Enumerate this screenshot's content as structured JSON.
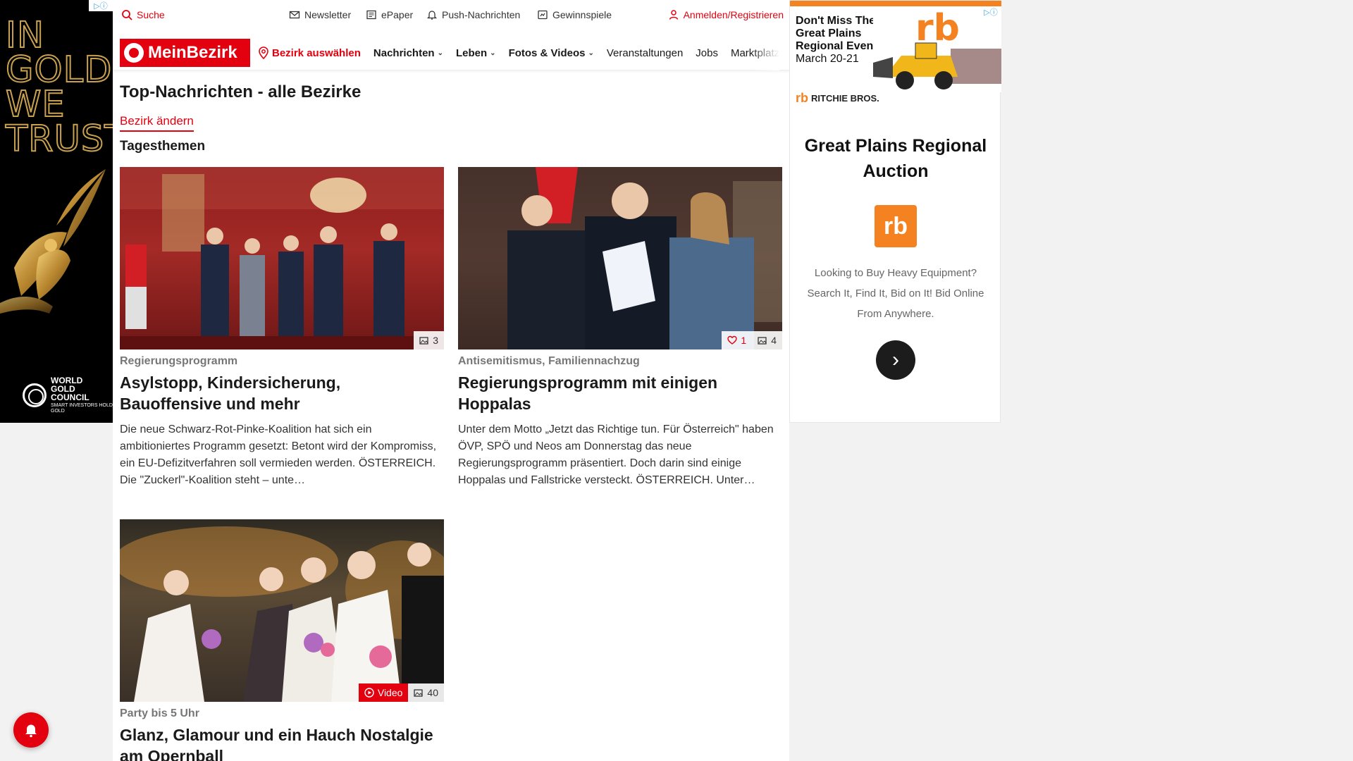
{
  "utility": {
    "search": "Suche",
    "newsletter": "Newsletter",
    "epaper": "ePaper",
    "push": "Push-Nachrichten",
    "games": "Gewinnspiele",
    "login": "Anmelden/Registrieren"
  },
  "nav": {
    "logo": "MeinBezirk",
    "district_select": "Bezirk auswählen",
    "items": [
      "Nachrichten",
      "Leben",
      "Fotos & Videos",
      "Veranstaltungen",
      "Jobs",
      "Marktplatz"
    ]
  },
  "main": {
    "title": "Top-Nachrichten - alle Bezirke",
    "change_district": "Bezirk ändern",
    "section": "Tagesthemen"
  },
  "articles": [
    {
      "topic": "Regierungsprogramm",
      "headline": "Asylstopp, Kindersicherung, Bauoffensive und mehr",
      "teaser": "Die neue Schwarz-Rot-Pinke-Koalition hat sich ein ambitioniertes Programm gesetzt: Betont wird der Kompromiss, ein EU-Defizitverfahren soll vermieden werden.  ÖSTERREICH. Die \"Zuckerl\"-Koalition steht – unte…",
      "photos": "3"
    },
    {
      "topic": "Antisemitismus, Familiennachzug",
      "headline": "Regierungsprogramm mit einigen Hoppalas",
      "teaser": "Unter dem Motto „Jetzt das Richtige tun. Für Österreich\" haben ÖVP, SPÖ und Neos am Donnerstag das neue Regierungsprogramm präsentiert. Doch darin sind einige Hoppalas und Fallstricke versteckt. ÖSTERREICH. Unter…",
      "likes": "1",
      "photos": "4"
    },
    {
      "topic": "Party bis 5 Uhr",
      "headline": "Glanz, Glamour und ein Hauch Nostalgie am Opernball",
      "video": "Video",
      "photos": "40"
    }
  ],
  "ad_left": {
    "headline": "IN GOLD WE TRUST",
    "brand": "WORLD GOLD COUNCIL",
    "tagline": "SMART INVESTORS HOLD GOLD"
  },
  "ad_right": {
    "banner_text": "Don't Miss The Great Plains Regional Event",
    "banner_date": "March 20-21",
    "brand": "RITCHIE BROS.",
    "brand_mark": "rb",
    "title": "Great Plains Regional Auction",
    "description": "Looking to Buy Heavy Equipment? Search It, Find It, Bid on It! Bid Online From Anywhere."
  },
  "colors": {
    "brand_red": "#e3000f",
    "ad_orange": "#f58220",
    "gold": "#c9a04e"
  }
}
